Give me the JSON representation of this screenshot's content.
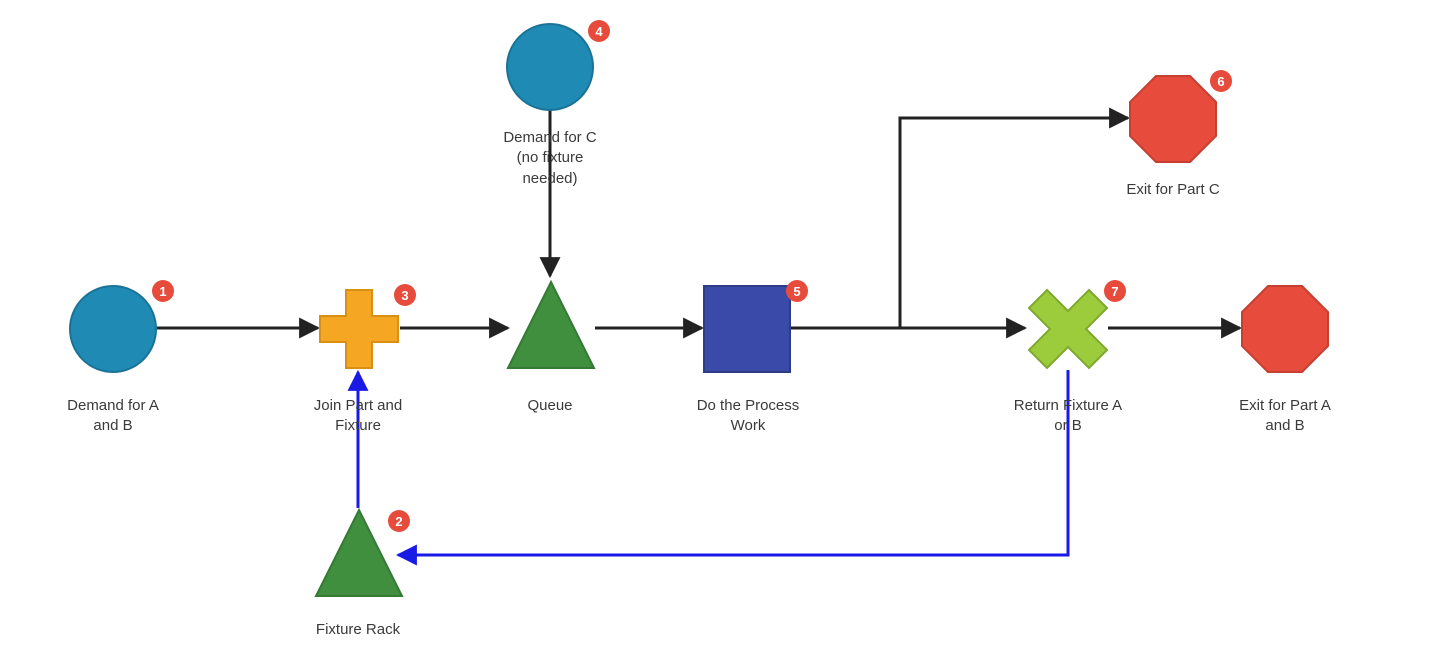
{
  "diagram": {
    "nodes": {
      "demandAB": {
        "label": "Demand for A\nand B",
        "badge": "1"
      },
      "fixtureRack": {
        "label": "Fixture Rack",
        "badge": "2"
      },
      "join": {
        "label": "Join Part and\nFixture",
        "badge": "3"
      },
      "demandC": {
        "label": "Demand for C\n(no fixture\nneeded)",
        "badge": "4"
      },
      "queue": {
        "label": "Queue"
      },
      "process": {
        "label": "Do the Process\nWork",
        "badge": "5"
      },
      "exitC": {
        "label": "Exit for Part C",
        "badge": "6"
      },
      "return": {
        "label": "Return Fixture A\nor B",
        "badge": "7"
      },
      "exitAB": {
        "label": "Exit for Part A\nand B"
      }
    },
    "colors": {
      "source": "#1f8bb5",
      "join": "#f5a623",
      "queue": "#3f8f3f",
      "process": "#3a4aa8",
      "split": "#9ccc3c",
      "exit": "#e64b3c",
      "badge": "#e64b3c",
      "flow": "#222222",
      "returnFlow": "#1a1ae6"
    }
  }
}
